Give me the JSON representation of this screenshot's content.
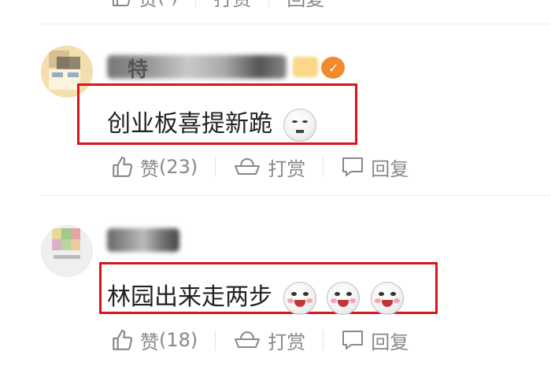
{
  "top_actions": {
    "like_label": "赞",
    "like_count": "( )",
    "reward_label": "打赏",
    "reply_label": "回复"
  },
  "comments": [
    {
      "username_visible": "特",
      "text": "创业板喜提新跪",
      "emoji": "smirk-emoji",
      "like_label": "赞",
      "like_count": "(23)",
      "reward_label": "打赏",
      "reply_label": "回复"
    },
    {
      "username_visible": "",
      "text": "林园出来走两步",
      "emoji": "smile-emoji",
      "like_label": "赞",
      "like_count": "(18)",
      "reward_label": "打赏",
      "reply_label": "回复"
    }
  ],
  "colors": {
    "highlight_box": "#d9151b",
    "action_gray": "#888888",
    "divider": "#ececec"
  }
}
